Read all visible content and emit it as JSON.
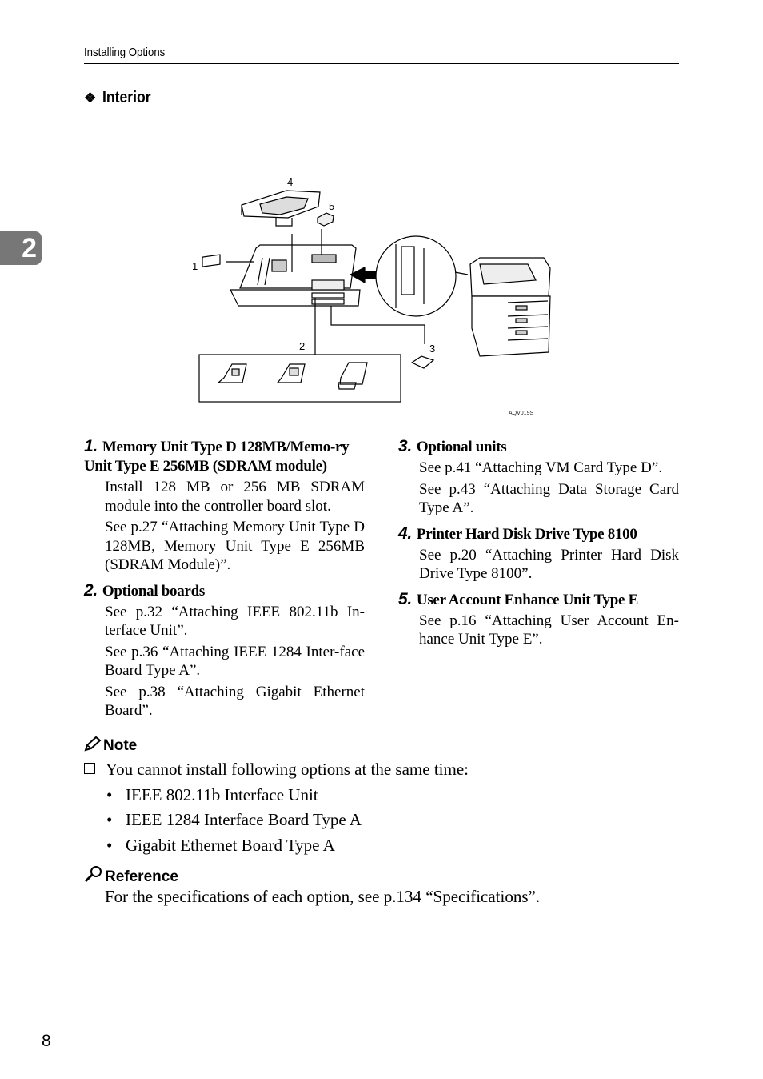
{
  "header": {
    "running_title": "Installing Options"
  },
  "chapter_tab": "2",
  "section": {
    "bullet_glyph": "❖",
    "title": "Interior"
  },
  "figure": {
    "callouts": [
      "1",
      "2",
      "3",
      "4",
      "5"
    ],
    "code": "AQV019S"
  },
  "items": [
    {
      "number": "1.",
      "title": "Memory Unit Type D 128MB/Memo-ry Unit Type E 256MB (SDRAM module)",
      "paragraphs": [
        "Install 128 MB or 256 MB SDRAM module into the controller board slot.",
        "See p.27 “Attaching Memory Unit Type D 128MB, Memory Unit Type E 256MB (SDRAM Module)”."
      ]
    },
    {
      "number": "2.",
      "title": "Optional boards",
      "paragraphs": [
        "See p.32 “Attaching IEEE 802.11b In-terface Unit”.",
        "See p.36 “Attaching IEEE 1284 Inter-face Board Type A”.",
        "See p.38 “Attaching Gigabit Ethernet Board”."
      ]
    },
    {
      "number": "3.",
      "title": "Optional units",
      "paragraphs": [
        "See p.41 “Attaching VM Card Type D”.",
        "See p.43 “Attaching Data Storage Card Type A”."
      ]
    },
    {
      "number": "4.",
      "title": "Printer Hard Disk Drive Type 8100",
      "paragraphs": [
        "See p.20 “Attaching Printer Hard Disk Drive Type 8100”."
      ]
    },
    {
      "number": "5.",
      "title": "User Account Enhance Unit Type E",
      "paragraphs": [
        "See p.16 “Attaching User Account En-hance Unit Type E”."
      ]
    }
  ],
  "note": {
    "heading": "Note",
    "checkbox_text": "You cannot install following options at the same time:",
    "bullets": [
      "IEEE 802.11b Interface Unit",
      "IEEE 1284 Interface Board Type A",
      "Gigabit Ethernet Board Type A"
    ]
  },
  "reference": {
    "heading": "Reference",
    "text": "For the specifications of each option, see p.134 “Specifications”."
  },
  "page_number": "8"
}
